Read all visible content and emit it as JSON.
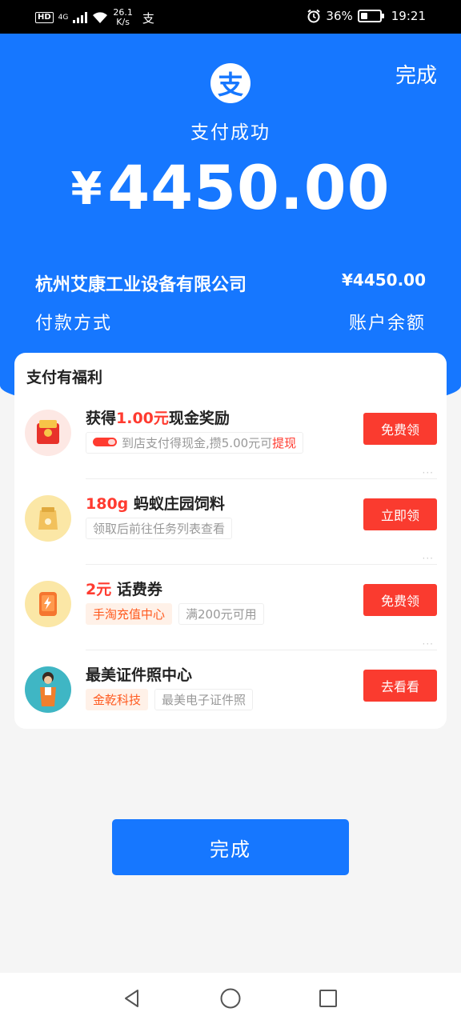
{
  "status_bar": {
    "hd": "HD",
    "network": "4G",
    "speed_value": "26.1",
    "speed_unit": "K/s",
    "app_glyph": "支",
    "battery": "36%",
    "battery_level": 0.36,
    "time": "19:21"
  },
  "header": {
    "done_label": "完成",
    "logo_glyph": "支",
    "title": "支付成功",
    "currency": "¥",
    "amount": "4450.00",
    "merchant": "杭州艾康工业设备有限公司",
    "merchant_amount": "¥4450.00",
    "pay_method_label": "付款方式",
    "pay_method_value": "账户余额"
  },
  "benefits": {
    "title": "支付有福利",
    "items": [
      {
        "prefix": "获得",
        "highlight": "1.00元",
        "suffix": "现金奖励",
        "tag1_text": "到店支付得现金,攒5.00元可",
        "tag1_highlight": "提现",
        "button": "免费领",
        "more": "···"
      },
      {
        "highlight": "180g",
        "suffix": " 蚂蚁庄园饲料",
        "tag1": "领取后前往任务列表查看",
        "button": "立即领",
        "more": "···"
      },
      {
        "highlight": "2元",
        "suffix": " 话费券",
        "tag1": "手淘充值中心",
        "tag2": "满200元可用",
        "button": "免费领",
        "more": "···"
      },
      {
        "suffix": "最美证件照中心",
        "tag1": "金乾科技",
        "tag2": "最美电子证件照",
        "button": "去看看"
      }
    ]
  },
  "footer": {
    "done_label": "完成"
  },
  "colors": {
    "brand_blue": "#1677ff",
    "accent_red": "#fa3b2f",
    "tag_orange": "#ff5a1f"
  },
  "icons": {
    "logo": "alipay-logo-icon",
    "item1": "red-envelope-icon",
    "item2": "feed-bag-icon",
    "item3": "phone-charge-icon",
    "item4": "person-photo-icon",
    "nav_back": "back-triangle-icon",
    "nav_home": "home-circle-icon",
    "nav_recent": "recents-square-icon"
  }
}
